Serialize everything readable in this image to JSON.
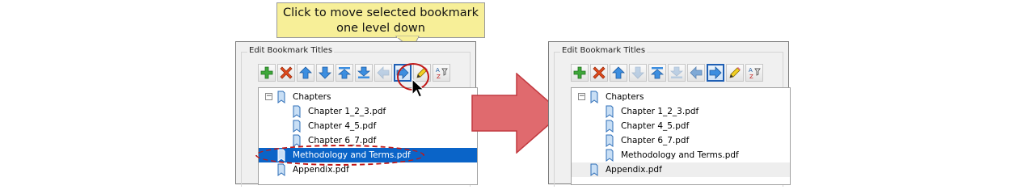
{
  "callout": {
    "line1": "Click to move selected bookmark",
    "line2": "one level down"
  },
  "panel_title": "Edit Bookmark Titles",
  "toolbar_icons": [
    "add-icon",
    "delete-icon",
    "move-up-icon",
    "move-down-icon",
    "move-to-top-icon",
    "move-to-bottom-icon",
    "promote-left-icon",
    "demote-right-icon",
    "edit-pencil-icon",
    "sort-az-icon"
  ],
  "before": {
    "title": "Edit Bookmark Titles",
    "tree": {
      "parent": "Chapters",
      "children": [
        "Chapter 1_2_3.pdf",
        "Chapter 4_5.pdf",
        "Chapter 6_7.pdf"
      ],
      "selected": "Methodology and Terms.pdf",
      "last": "Appendix.pdf"
    }
  },
  "after": {
    "title": "Edit Bookmark Titles",
    "tree": {
      "parent": "Chapters",
      "children": [
        "Chapter 1_2_3.pdf",
        "Chapter 4_5.pdf",
        "Chapter 6_7.pdf",
        "Methodology and Terms.pdf"
      ],
      "last": "Appendix.pdf"
    }
  },
  "colors": {
    "selection": "#0a64c8",
    "annotation": "#c01818",
    "arrow_fill": "#e06a6e",
    "callout_bg": "#f7ef98"
  }
}
